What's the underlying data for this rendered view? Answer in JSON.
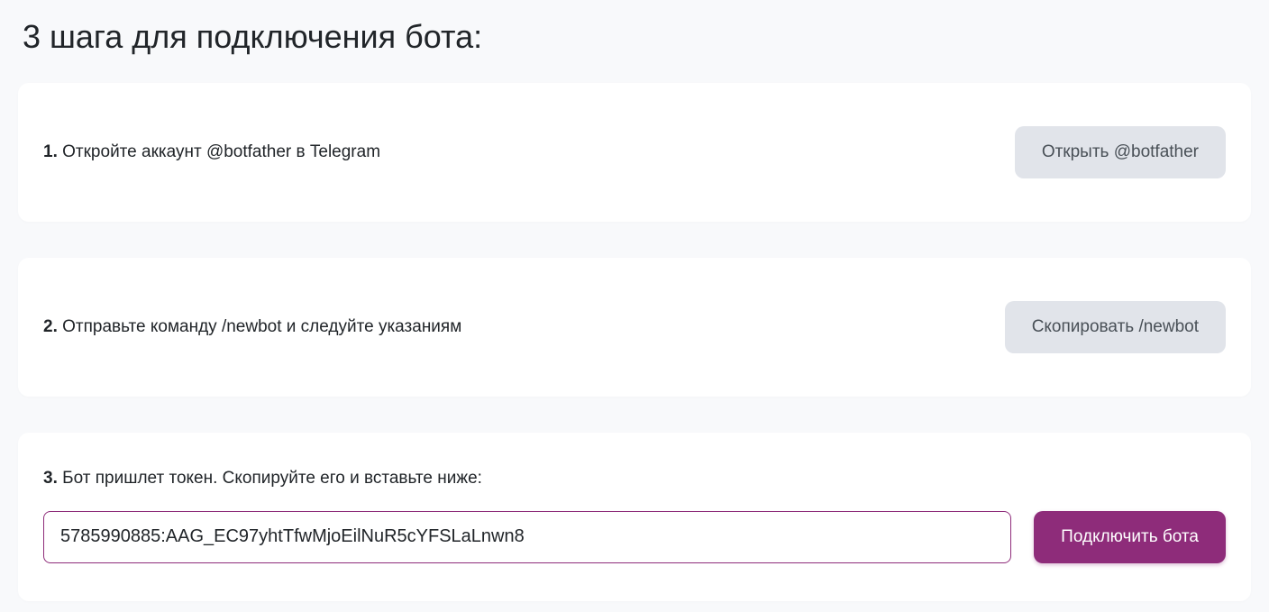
{
  "title": "3 шага для подключения бота:",
  "steps": {
    "step1": {
      "number": "1.",
      "text": " Откройте аккаунт @botfather в Telegram",
      "button": "Открыть @botfather"
    },
    "step2": {
      "number": "2.",
      "text": " Отправьте команду /newbot и следуйте указаниям",
      "button": "Скопировать /newbot"
    },
    "step3": {
      "number": "3.",
      "text": " Бот пришлет токен. Скопируйте его и вставьте ниже:",
      "token_value": "5785990885:AAG_EC97yhtTfwMjoEilNuR5cYFSLaLnwn8",
      "button": "Подключить бота"
    }
  }
}
